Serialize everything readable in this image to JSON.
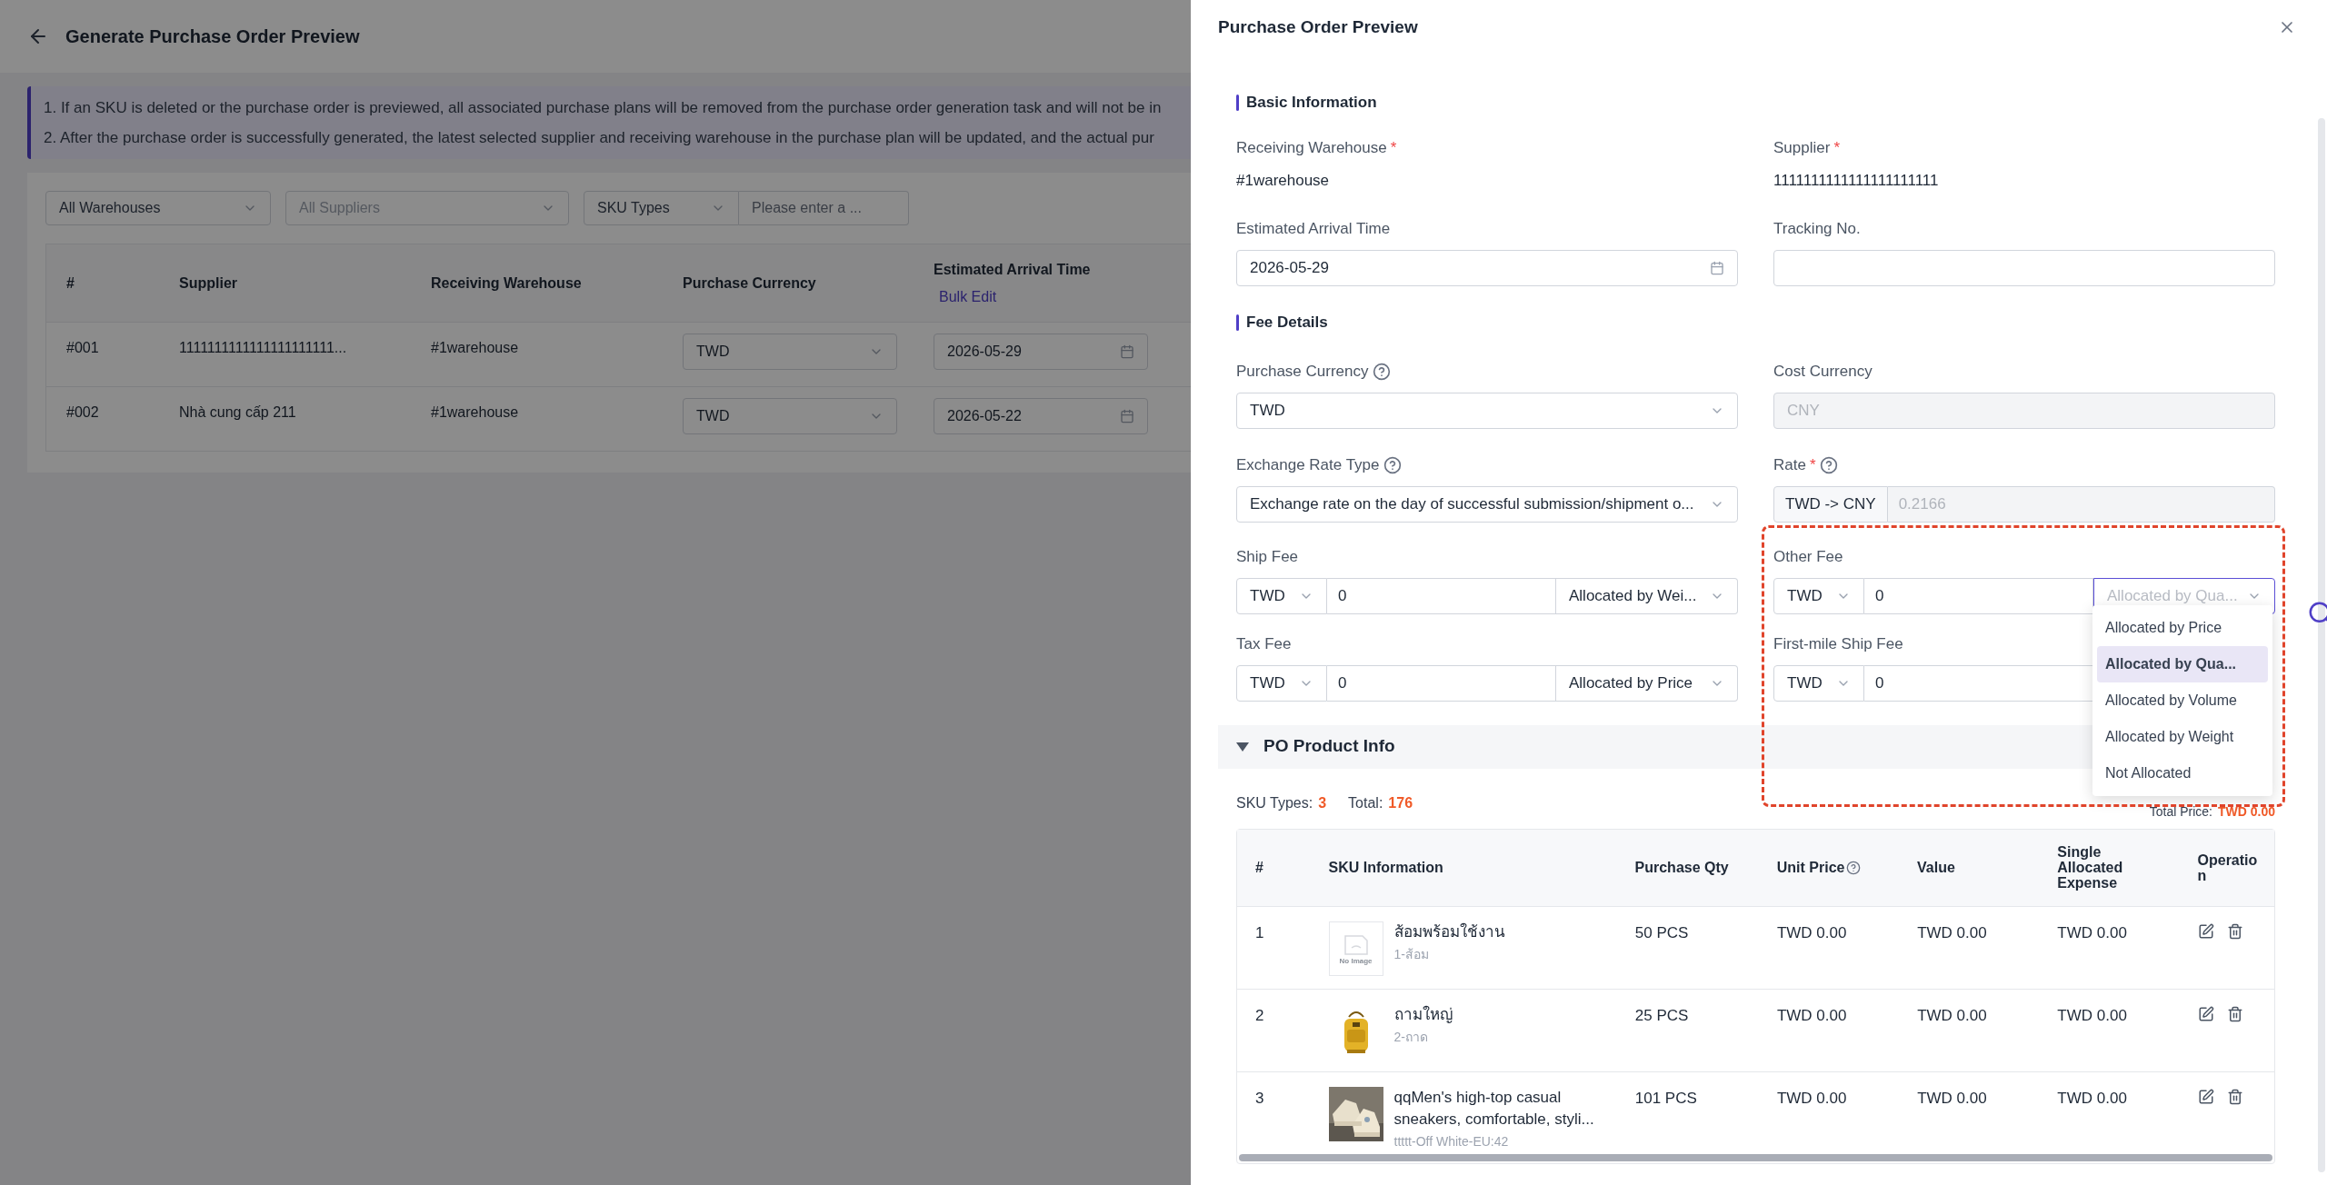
{
  "page": {
    "title": "Generate Purchase Order Preview",
    "notices": [
      "1. If an SKU is deleted or the purchase order is previewed, all associated purchase plans will be removed from the purchase order generation task and will not be in",
      "2. After the purchase order is successfully generated, the latest selected supplier and receiving warehouse in the purchase plan will be updated, and the actual pur"
    ],
    "filters": {
      "warehouse": "All Warehouses",
      "supplier_placeholder": "All Suppliers",
      "sku_type": "SKU Types",
      "search_placeholder": "Please enter a ..."
    },
    "table": {
      "columns": [
        "#",
        "Supplier",
        "Receiving Warehouse",
        "Purchase Currency",
        "Estimated Arrival Time"
      ],
      "bulk_edit": "Bulk Edit",
      "rows": [
        {
          "no": "#001",
          "supplier": "1111111111111111111111...",
          "warehouse": "#1warehouse",
          "currency": "TWD",
          "date": "2026-05-29"
        },
        {
          "no": "#002",
          "supplier": "Nhà cung cấp 211",
          "warehouse": "#1warehouse",
          "currency": "TWD",
          "date": "2026-05-22"
        }
      ]
    }
  },
  "drawer": {
    "title": "Purchase Order Preview",
    "basic": {
      "heading": "Basic Information",
      "receiving_warehouse": {
        "label": "Receiving Warehouse",
        "required_mark": "*",
        "value": "#1warehouse"
      },
      "supplier": {
        "label": "Supplier",
        "required_mark": "*",
        "value": "1111111111111111111111"
      },
      "arrival": {
        "label": "Estimated Arrival Time",
        "value": "2026-05-29"
      },
      "tracking": {
        "label": "Tracking No."
      }
    },
    "fees": {
      "heading": "Fee Details",
      "purchase_currency": {
        "label": "Purchase Currency",
        "value": "TWD"
      },
      "cost_currency": {
        "label": "Cost Currency",
        "value": "CNY",
        "disabled": true
      },
      "exchange_rate_type": {
        "label": "Exchange Rate Type",
        "value": "Exchange rate on the day of successful submission/shipment o..."
      },
      "rate": {
        "label": "Rate",
        "required_mark": "*",
        "prefix": "TWD -> CNY",
        "value": "0.2166"
      },
      "items": [
        {
          "label": "Ship Fee",
          "currency": "TWD",
          "amount": "0",
          "allocation": "Allocated by Wei...",
          "open": false
        },
        {
          "label": "Other Fee",
          "currency": "TWD",
          "amount": "0",
          "allocation": "Allocated by Qua...",
          "open": true
        },
        {
          "label": "Tax Fee",
          "currency": "TWD",
          "amount": "0",
          "allocation": "Allocated by Price",
          "open": false
        },
        {
          "label": "First-mile Ship Fee",
          "currency": "TWD",
          "amount": "0",
          "open": false
        }
      ],
      "options": [
        {
          "label": "Allocated by Price",
          "selected": false
        },
        {
          "label": "Allocated by Qua...",
          "selected": true
        },
        {
          "label": "Allocated by Volume",
          "selected": false
        },
        {
          "label": "Allocated by Weight",
          "selected": false
        },
        {
          "label": "Not Allocated",
          "selected": false
        }
      ]
    },
    "products": {
      "heading": "PO Product Info",
      "expanded": true,
      "sku_types_label": "SKU Types:",
      "sku_types": "3",
      "total_label": "Total:",
      "total": "176",
      "total_price_label": "Total Price:",
      "total_price": "TWD 0.00",
      "columns": [
        "#",
        "SKU Information",
        "Purchase Qty",
        "Unit Price",
        "Value",
        "Single Allocated Expense",
        "Operation"
      ],
      "rows": [
        {
          "no": "1",
          "kind": "placeholder",
          "no_image_text": "No Image",
          "name": "ส้อมพร้อมใช้งาน",
          "sku": "1-ส้อม",
          "qty": "50 PCS",
          "unit_price": "TWD 0.00",
          "value": "TWD 0.00",
          "allocated": "TWD 0.00"
        },
        {
          "no": "2",
          "kind": "picture",
          "name": "ถามใหญ่",
          "sku": "2-ถาด",
          "qty": "25 PCS",
          "unit_price": "TWD 0.00",
          "value": "TWD 0.00",
          "allocated": "TWD 0.00"
        },
        {
          "no": "3",
          "kind": "picture",
          "name": "qqMen's high-top casual sneakers, comfortable, styli...",
          "sku": "ttttt-Off White-EU:42",
          "qty": "101 PCS",
          "unit_price": "TWD 0.00",
          "value": "TWD 0.00",
          "allocated": "TWD 0.00"
        }
      ]
    }
  }
}
